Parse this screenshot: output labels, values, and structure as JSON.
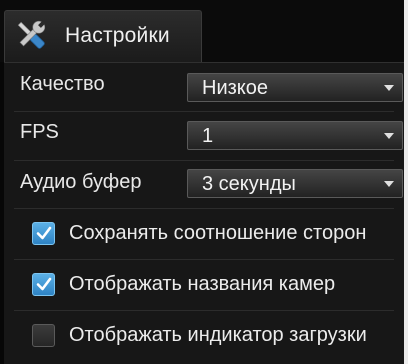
{
  "tab": {
    "icon": "tools-icon",
    "label": "Настройки"
  },
  "settings": {
    "quality": {
      "label": "Качество",
      "value": "Низкое"
    },
    "fps": {
      "label": "FPS",
      "value": "1"
    },
    "audio_buffer": {
      "label": "Аудио буфер",
      "value": "3 секунды"
    }
  },
  "options": [
    {
      "label": "Сохранять соотношение сторон",
      "checked": true
    },
    {
      "label": "Отображать названия камер",
      "checked": true
    },
    {
      "label": "Отображать индикатор загрузки",
      "checked": false
    }
  ],
  "colors": {
    "background": "#171717",
    "checkbox_checked": "#3a95d6",
    "text": "#e8e8e8"
  }
}
